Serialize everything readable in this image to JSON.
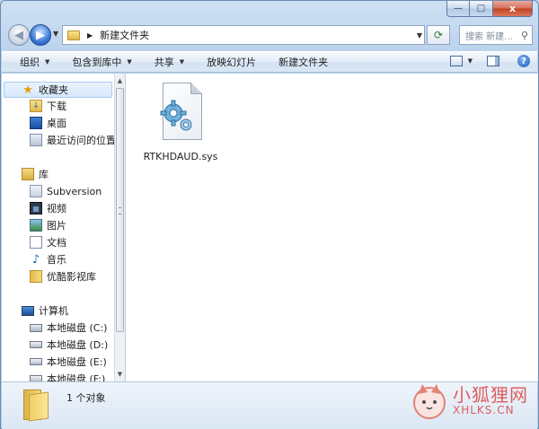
{
  "window": {
    "caption": {
      "min": "—",
      "max": "□",
      "close": "x"
    }
  },
  "nav": {
    "back_glyph": "◀",
    "fwd_glyph": "▶",
    "history_glyph": "▼",
    "address": {
      "separator": "▶",
      "path": "新建文件夹",
      "drop_glyph": "▼"
    },
    "refresh_glyph": "⟳",
    "search": {
      "placeholder": "搜索 新建...",
      "icon": "search-icon"
    }
  },
  "toolbar": {
    "items": [
      {
        "label": "组织",
        "has_dropdown": true
      },
      {
        "label": "包含到库中",
        "has_dropdown": true
      },
      {
        "label": "共享",
        "has_dropdown": true
      },
      {
        "label": "放映幻灯片",
        "has_dropdown": false
      },
      {
        "label": "新建文件夹",
        "has_dropdown": false
      }
    ],
    "dropdown_glyph": "▼",
    "help_glyph": "?"
  },
  "sidebar": {
    "favorites": {
      "label": "收藏夹",
      "items": [
        {
          "label": "下载",
          "icon": "download-icon"
        },
        {
          "label": "桌面",
          "icon": "desktop-icon"
        },
        {
          "label": "最近访问的位置",
          "icon": "recent-places-icon"
        }
      ]
    },
    "libraries": {
      "label": "库",
      "items": [
        {
          "label": "Subversion",
          "icon": "library-icon"
        },
        {
          "label": "视频",
          "icon": "video-icon"
        },
        {
          "label": "图片",
          "icon": "picture-icon"
        },
        {
          "label": "文档",
          "icon": "document-icon"
        },
        {
          "label": "音乐",
          "icon": "music-icon"
        },
        {
          "label": "优酷影视库",
          "icon": "folder-icon"
        }
      ]
    },
    "computer": {
      "label": "计算机",
      "items": [
        {
          "label": "本地磁盘 (C:)",
          "icon": "system-drive-icon"
        },
        {
          "label": "本地磁盘 (D:)",
          "icon": "drive-icon"
        },
        {
          "label": "本地磁盘 (E:)",
          "icon": "drive-icon"
        },
        {
          "label": "本地磁盘 (F:)",
          "icon": "drive-icon"
        }
      ]
    },
    "scroll_up": "▲",
    "scroll_down": "▼"
  },
  "content": {
    "files": [
      {
        "name": "RTKHDAUD.sys",
        "icon": "system-file-gear-icon"
      }
    ]
  },
  "status": {
    "text": "1 个对象"
  },
  "watermark": {
    "cn": "小狐狸网",
    "en": "XHLKS.CN"
  },
  "colors": {
    "window_frame": "#bcd3ec",
    "toolbar": "#dae7f5",
    "selection": "#d7e8fb",
    "watermark": "#dd4444"
  }
}
